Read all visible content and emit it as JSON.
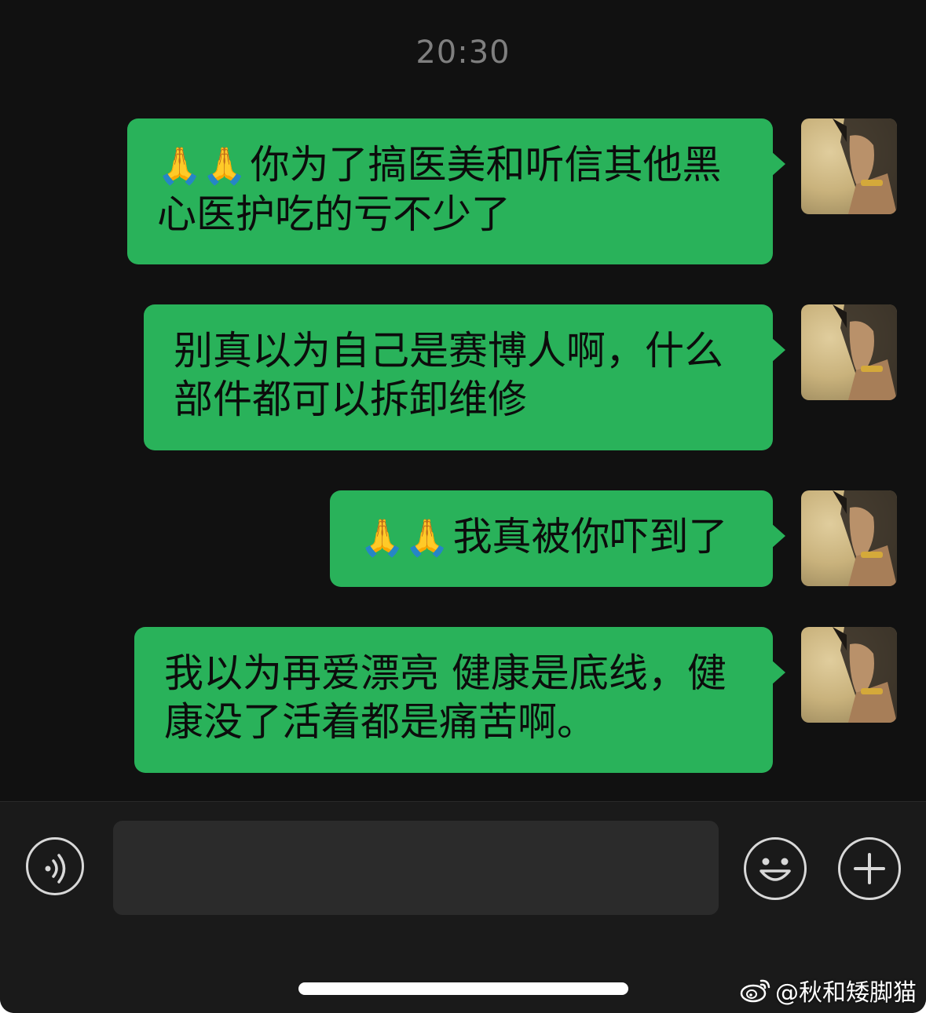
{
  "timestamp": "20:30",
  "messages": [
    {
      "emoji": "🙏🙏",
      "text": "你为了搞医美和听信其他黑心医护吃的亏不少了"
    },
    {
      "emoji": "",
      "text": "别真以为自己是赛博人啊，什么部件都可以拆卸维修"
    },
    {
      "emoji": "🙏🙏",
      "text": "我真被你吓到了"
    },
    {
      "emoji": "",
      "text": "我以为再爱漂亮 健康是底线，健康没了活着都是痛苦啊。"
    }
  ],
  "composer": {
    "input_value": "",
    "voice_icon": "voice-icon",
    "emoji_icon": "emoji-face-icon",
    "plus_icon": "plus-icon"
  },
  "watermark": {
    "text": "@秋和矮脚猫",
    "icon": "weibo-icon"
  },
  "colors": {
    "background": "#111111",
    "bubble": "#29b25a",
    "timestamp": "#7f7f7f"
  }
}
